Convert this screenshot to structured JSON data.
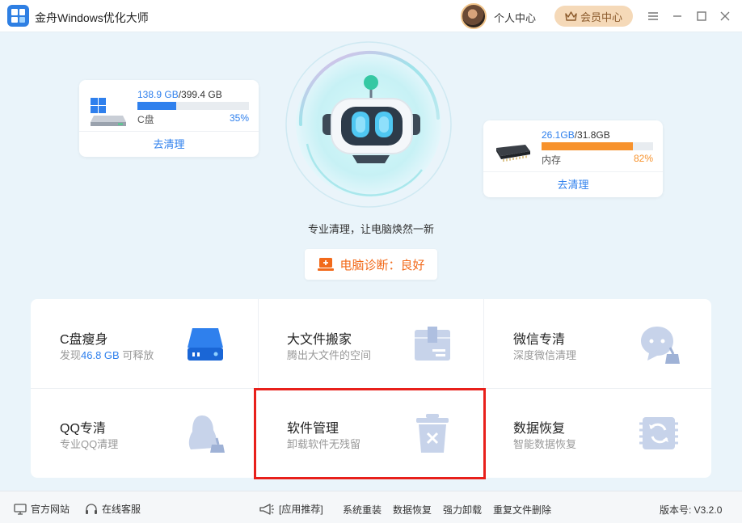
{
  "app": {
    "title": "金舟Windows优化大师"
  },
  "header": {
    "profile_label": "个人中心",
    "vip_label": "会员中心"
  },
  "disk": {
    "used": "138.9 GB",
    "total": "/399.4 GB",
    "label": "C盘",
    "percent_text": "35%",
    "percent": 35,
    "clean_label": "去清理"
  },
  "memory": {
    "used": "26.1GB",
    "total": "/31.8GB",
    "label": "内存",
    "percent_text": "82%",
    "percent": 82,
    "clean_label": "去清理"
  },
  "tagline": "专业清理，让电脑焕然一新",
  "diagnosis": {
    "label": "电脑诊断：良好"
  },
  "tiles": [
    {
      "title": "C盘瘦身",
      "sub_prefix": "发现",
      "sub_highlight": "46.8 GB",
      "sub_suffix": " 可释放"
    },
    {
      "title": "大文件搬家",
      "sub": "腾出大文件的空间"
    },
    {
      "title": "微信专清",
      "sub": "深度微信清理"
    },
    {
      "title": "QQ专清",
      "sub": "专业QQ清理"
    },
    {
      "title": "软件管理",
      "sub": "卸载软件无残留"
    },
    {
      "title": "数据恢复",
      "sub": "智能数据恢复"
    }
  ],
  "footer": {
    "website": "官方网站",
    "support": "在线客服",
    "recommend": "[应用推荐]",
    "links": [
      "系统重装",
      "数据恢复",
      "强力卸载",
      "重复文件删除"
    ],
    "version": "版本号: V3.2.0"
  },
  "colors": {
    "accent": "#2f80ed",
    "memory_bar": "#f7922c",
    "diagnosis": "#f26a1b",
    "vip_bg": "#f5d9b8",
    "highlight_box": "#e8201b"
  }
}
